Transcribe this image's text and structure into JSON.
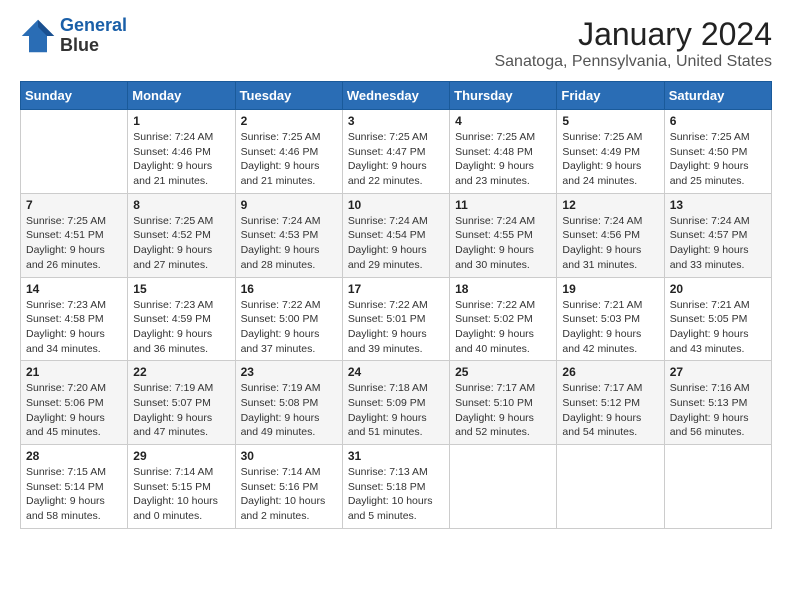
{
  "header": {
    "logo_line1": "General",
    "logo_line2": "Blue",
    "title": "January 2024",
    "subtitle": "Sanatoga, Pennsylvania, United States"
  },
  "calendar": {
    "days_of_week": [
      "Sunday",
      "Monday",
      "Tuesday",
      "Wednesday",
      "Thursday",
      "Friday",
      "Saturday"
    ],
    "weeks": [
      [
        {
          "number": "",
          "detail": ""
        },
        {
          "number": "1",
          "detail": "Sunrise: 7:24 AM\nSunset: 4:46 PM\nDaylight: 9 hours\nand 21 minutes."
        },
        {
          "number": "2",
          "detail": "Sunrise: 7:25 AM\nSunset: 4:46 PM\nDaylight: 9 hours\nand 21 minutes."
        },
        {
          "number": "3",
          "detail": "Sunrise: 7:25 AM\nSunset: 4:47 PM\nDaylight: 9 hours\nand 22 minutes."
        },
        {
          "number": "4",
          "detail": "Sunrise: 7:25 AM\nSunset: 4:48 PM\nDaylight: 9 hours\nand 23 minutes."
        },
        {
          "number": "5",
          "detail": "Sunrise: 7:25 AM\nSunset: 4:49 PM\nDaylight: 9 hours\nand 24 minutes."
        },
        {
          "number": "6",
          "detail": "Sunrise: 7:25 AM\nSunset: 4:50 PM\nDaylight: 9 hours\nand 25 minutes."
        }
      ],
      [
        {
          "number": "7",
          "detail": "Sunrise: 7:25 AM\nSunset: 4:51 PM\nDaylight: 9 hours\nand 26 minutes."
        },
        {
          "number": "8",
          "detail": "Sunrise: 7:25 AM\nSunset: 4:52 PM\nDaylight: 9 hours\nand 27 minutes."
        },
        {
          "number": "9",
          "detail": "Sunrise: 7:24 AM\nSunset: 4:53 PM\nDaylight: 9 hours\nand 28 minutes."
        },
        {
          "number": "10",
          "detail": "Sunrise: 7:24 AM\nSunset: 4:54 PM\nDaylight: 9 hours\nand 29 minutes."
        },
        {
          "number": "11",
          "detail": "Sunrise: 7:24 AM\nSunset: 4:55 PM\nDaylight: 9 hours\nand 30 minutes."
        },
        {
          "number": "12",
          "detail": "Sunrise: 7:24 AM\nSunset: 4:56 PM\nDaylight: 9 hours\nand 31 minutes."
        },
        {
          "number": "13",
          "detail": "Sunrise: 7:24 AM\nSunset: 4:57 PM\nDaylight: 9 hours\nand 33 minutes."
        }
      ],
      [
        {
          "number": "14",
          "detail": "Sunrise: 7:23 AM\nSunset: 4:58 PM\nDaylight: 9 hours\nand 34 minutes."
        },
        {
          "number": "15",
          "detail": "Sunrise: 7:23 AM\nSunset: 4:59 PM\nDaylight: 9 hours\nand 36 minutes."
        },
        {
          "number": "16",
          "detail": "Sunrise: 7:22 AM\nSunset: 5:00 PM\nDaylight: 9 hours\nand 37 minutes."
        },
        {
          "number": "17",
          "detail": "Sunrise: 7:22 AM\nSunset: 5:01 PM\nDaylight: 9 hours\nand 39 minutes."
        },
        {
          "number": "18",
          "detail": "Sunrise: 7:22 AM\nSunset: 5:02 PM\nDaylight: 9 hours\nand 40 minutes."
        },
        {
          "number": "19",
          "detail": "Sunrise: 7:21 AM\nSunset: 5:03 PM\nDaylight: 9 hours\nand 42 minutes."
        },
        {
          "number": "20",
          "detail": "Sunrise: 7:21 AM\nSunset: 5:05 PM\nDaylight: 9 hours\nand 43 minutes."
        }
      ],
      [
        {
          "number": "21",
          "detail": "Sunrise: 7:20 AM\nSunset: 5:06 PM\nDaylight: 9 hours\nand 45 minutes."
        },
        {
          "number": "22",
          "detail": "Sunrise: 7:19 AM\nSunset: 5:07 PM\nDaylight: 9 hours\nand 47 minutes."
        },
        {
          "number": "23",
          "detail": "Sunrise: 7:19 AM\nSunset: 5:08 PM\nDaylight: 9 hours\nand 49 minutes."
        },
        {
          "number": "24",
          "detail": "Sunrise: 7:18 AM\nSunset: 5:09 PM\nDaylight: 9 hours\nand 51 minutes."
        },
        {
          "number": "25",
          "detail": "Sunrise: 7:17 AM\nSunset: 5:10 PM\nDaylight: 9 hours\nand 52 minutes."
        },
        {
          "number": "26",
          "detail": "Sunrise: 7:17 AM\nSunset: 5:12 PM\nDaylight: 9 hours\nand 54 minutes."
        },
        {
          "number": "27",
          "detail": "Sunrise: 7:16 AM\nSunset: 5:13 PM\nDaylight: 9 hours\nand 56 minutes."
        }
      ],
      [
        {
          "number": "28",
          "detail": "Sunrise: 7:15 AM\nSunset: 5:14 PM\nDaylight: 9 hours\nand 58 minutes."
        },
        {
          "number": "29",
          "detail": "Sunrise: 7:14 AM\nSunset: 5:15 PM\nDaylight: 10 hours\nand 0 minutes."
        },
        {
          "number": "30",
          "detail": "Sunrise: 7:14 AM\nSunset: 5:16 PM\nDaylight: 10 hours\nand 2 minutes."
        },
        {
          "number": "31",
          "detail": "Sunrise: 7:13 AM\nSunset: 5:18 PM\nDaylight: 10 hours\nand 5 minutes."
        },
        {
          "number": "",
          "detail": ""
        },
        {
          "number": "",
          "detail": ""
        },
        {
          "number": "",
          "detail": ""
        }
      ]
    ]
  }
}
